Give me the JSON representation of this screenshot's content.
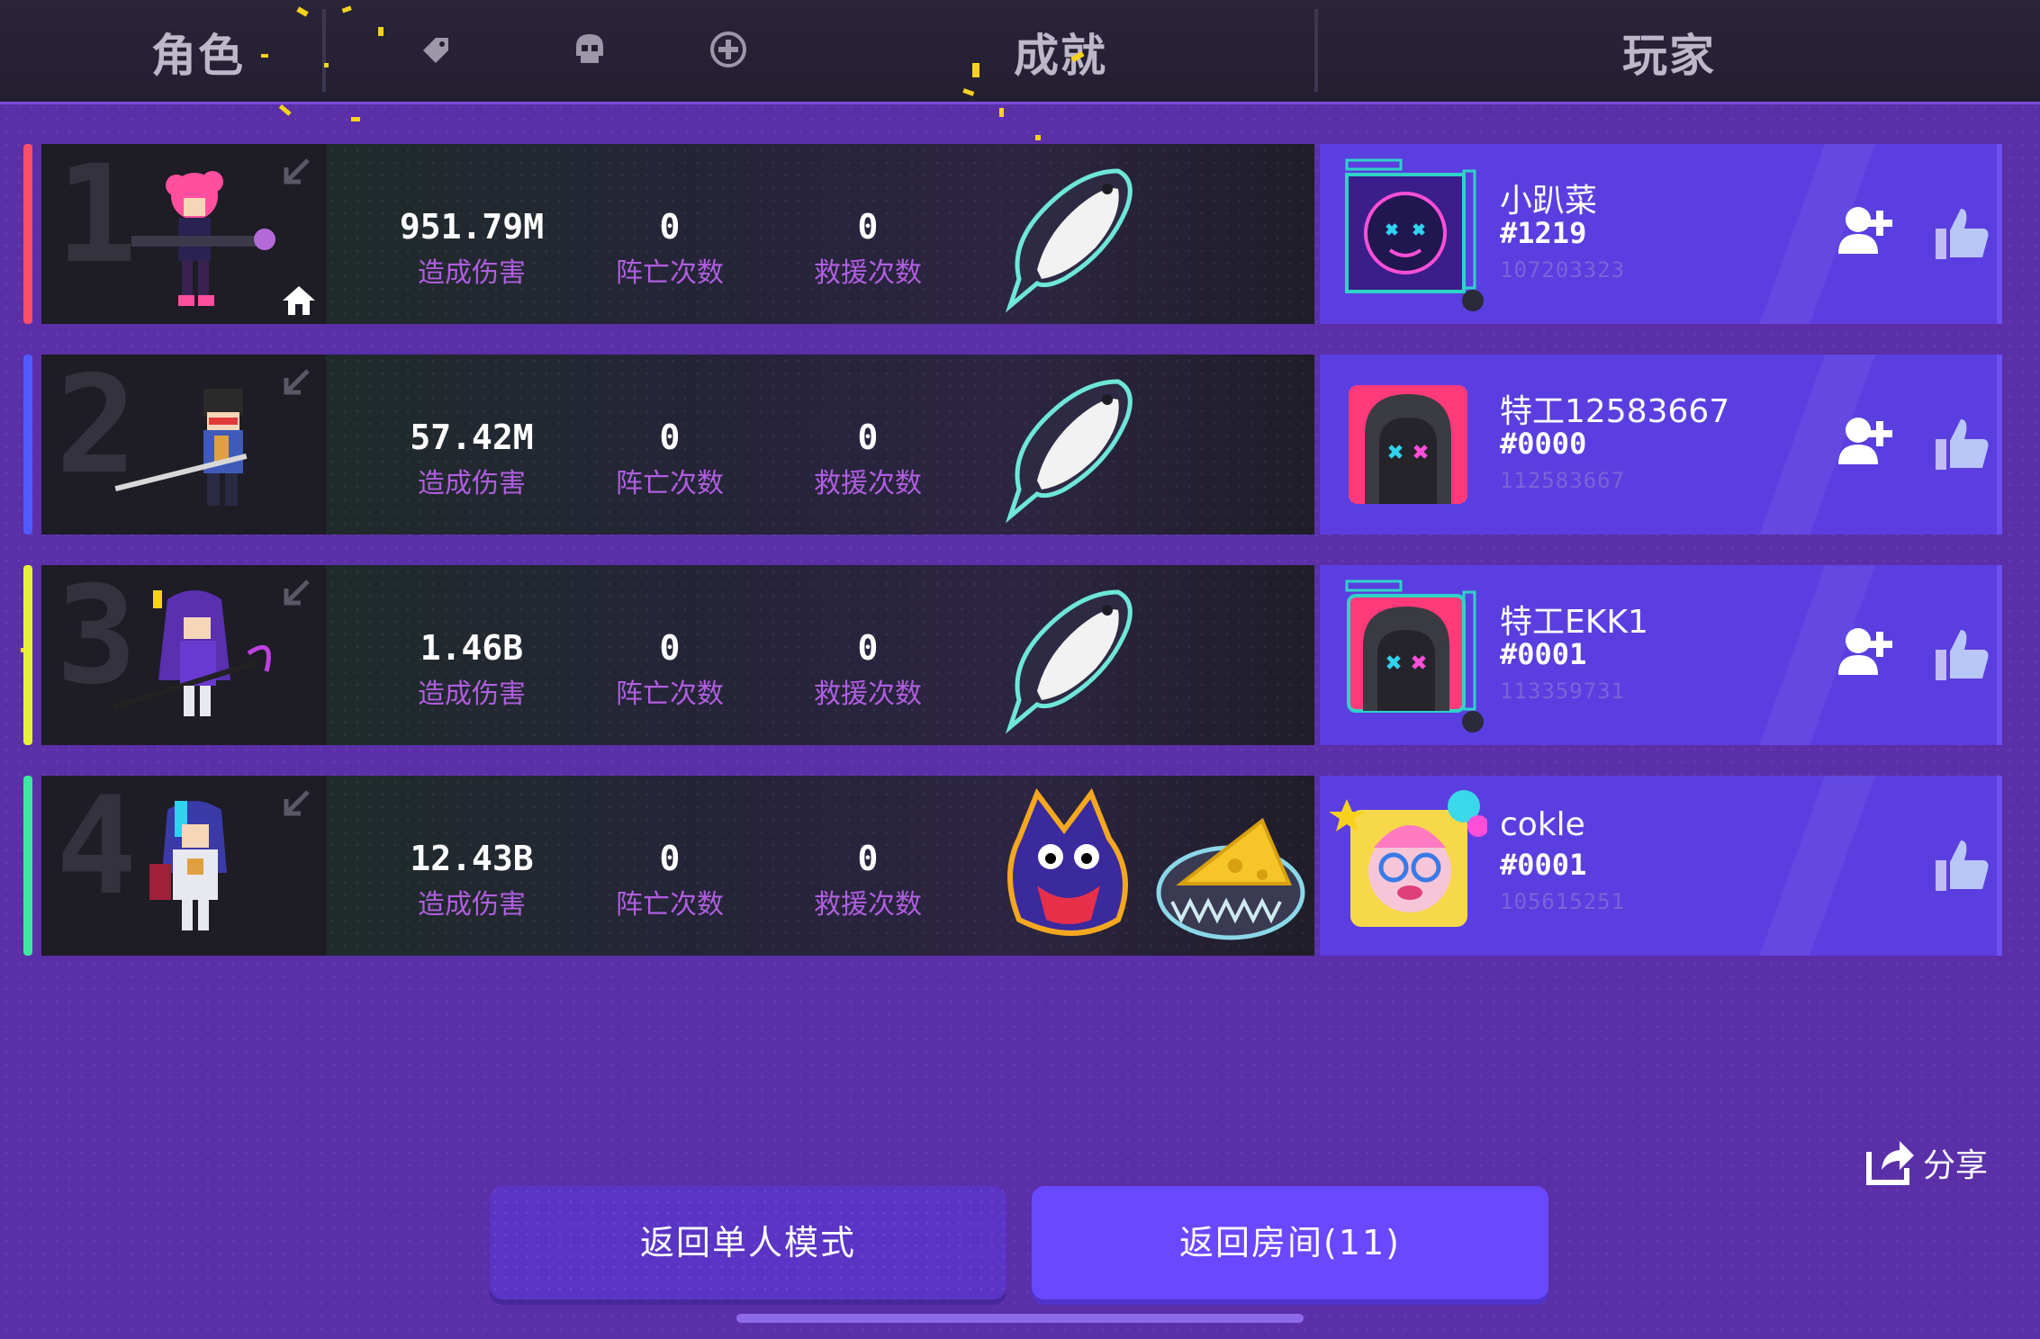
{
  "header": {
    "tab_character": "角色",
    "tab_achievement": "成就",
    "tab_player": "玩家",
    "filter_icons": [
      "tag-icon",
      "skull-icon",
      "plus-circle-icon"
    ]
  },
  "rows": [
    {
      "rank": "1",
      "rank_color": "#ff4d6a",
      "is_host": true,
      "damage": "951.79M",
      "damage_label": "造成伤害",
      "deaths": "0",
      "deaths_label": "阵亡次数",
      "rescues": "0",
      "rescues_label": "救援次数",
      "achievements": [
        "fish-icon"
      ],
      "player": {
        "name": "小趴菜",
        "tag": "#1219",
        "id": "107203323",
        "avatar_frame": "neon-abyss",
        "show_add_friend": true
      }
    },
    {
      "rank": "2",
      "rank_color": "#4f5bff",
      "is_host": false,
      "damage": "57.42M",
      "damage_label": "造成伤害",
      "deaths": "0",
      "deaths_label": "阵亡次数",
      "rescues": "0",
      "rescues_label": "救援次数",
      "achievements": [
        "fish-icon"
      ],
      "player": {
        "name": "特工12583667",
        "tag": "#0000",
        "id": "112583667",
        "avatar_frame": "none",
        "show_add_friend": true
      }
    },
    {
      "rank": "3",
      "rank_color": "#e6f23a",
      "is_host": false,
      "damage": "1.46B",
      "damage_label": "造成伤害",
      "deaths": "0",
      "deaths_label": "阵亡次数",
      "rescues": "0",
      "rescues_label": "救援次数",
      "achievements": [
        "fish-icon"
      ],
      "player": {
        "name": "特工EKK1",
        "tag": "#0001",
        "id": "113359731",
        "avatar_frame": "neon-abyss",
        "show_add_friend": true
      }
    },
    {
      "rank": "4",
      "rank_color": "#3de8a0",
      "is_host": false,
      "damage": "12.43B",
      "damage_label": "造成伤害",
      "deaths": "0",
      "deaths_label": "阵亡次数",
      "rescues": "0",
      "rescues_label": "救援次数",
      "achievements": [
        "wolf-icon",
        "cheese-trap-icon"
      ],
      "player": {
        "name": "cokle",
        "tag": "#0001",
        "id": "105615251",
        "avatar_frame": "party",
        "show_add_friend": false
      }
    }
  ],
  "share_label": "分享",
  "buttons": {
    "back_single": "返回单人模式",
    "back_room": "返回房间(11)"
  },
  "colors": {
    "background": "#5a2fa8",
    "player_panel": "#5b3ee0",
    "stat_label": "#b05ee0",
    "room_button": "#6a48ff"
  }
}
